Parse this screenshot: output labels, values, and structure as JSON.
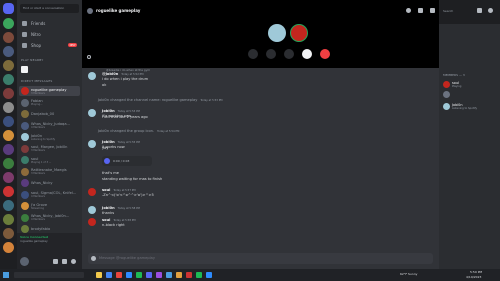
{
  "sidebar": {
    "search_placeholder": "Find or start a conversation",
    "nav": [
      {
        "label": "Friends",
        "badge": ""
      },
      {
        "label": "Nitro",
        "badge": ""
      },
      {
        "label": "Shop",
        "badge": "NEW"
      }
    ],
    "section_play": "PLAY NEARBY",
    "section_dm": "DIRECT MESSAGES",
    "dms": [
      {
        "name": "roguelike gameplay",
        "sub": "3 Members",
        "active": true
      },
      {
        "name": "Fabian",
        "sub": "Playing..."
      },
      {
        "name": "Danjakob_00",
        "sub": ""
      },
      {
        "name": "Whos_Nicky_Judaqa...",
        "sub": "4 Members"
      },
      {
        "name": "Jobi0n",
        "sub": "Listening to Spotify"
      },
      {
        "name": "soul, Margee, Jobi0n",
        "sub": "3 Members"
      },
      {
        "name": "soul",
        "sub": "Playing 1 of 3 ..."
      },
      {
        "name": "Rattlesnake_Maegis",
        "sub": "3 Members"
      },
      {
        "name": "Whos_Nicky",
        "sub": ""
      },
      {
        "name": "soul, Sigma/COL, Knifel...",
        "sub": "4 Members"
      },
      {
        "name": "J'a Grove",
        "sub": "Streaming"
      },
      {
        "name": "Whos_Nicky, Jobi0n...",
        "sub": "4 Members"
      },
      {
        "name": "brodyfabio",
        "sub": ""
      }
    ],
    "voice": {
      "status": "Voice Connected",
      "channel": "roguelike gameplay"
    }
  },
  "header": {
    "title": "roguelike gameplay",
    "search": "Search"
  },
  "chat": {
    "messages": [
      {
        "type": "msg",
        "name": "@Jobi0n",
        "time": "Today at 5:52 PM",
        "text": "i do when i play the drum",
        "reply": "@breadie i do when at the gym"
      },
      {
        "type": "msg",
        "name": "",
        "time": "",
        "text": "ok"
      },
      {
        "type": "sys",
        "text": "Jobi0n changed the channel name: roguelike gameplay",
        "time": "Today at 5:53 PM"
      },
      {
        "type": "msg",
        "name": "Jobi0n",
        "time": "Today at 5:53 PM",
        "text": "it's working now"
      },
      {
        "type": "msg",
        "name": "",
        "time": "",
        "text": "i did that like 2 years ago"
      },
      {
        "type": "sys",
        "text": "Jobi0n changed the group icon.",
        "time": "Today at 5:54 PM"
      },
      {
        "type": "msg",
        "name": "Jobi0n",
        "time": "Today at 5:55 PM",
        "text": "it works now"
      },
      {
        "type": "msg",
        "name": "",
        "time": "",
        "text": "yay"
      },
      {
        "type": "audio",
        "duration": "0:00 / 0:03"
      },
      {
        "type": "msg",
        "name": "",
        "time": "",
        "text": "that's me"
      },
      {
        "type": "msg",
        "name": "",
        "time": "",
        "text": "standing waiting for mas to finish"
      },
      {
        "type": "msg",
        "name": "soul",
        "time": "Today at 5:57 PM",
        "text": "-Zn^<('o'<^o^^>'o')>^>5"
      },
      {
        "type": "msg",
        "name": "Jobi0n",
        "time": "Today at 5:58 PM",
        "text": "thanks"
      },
      {
        "type": "msg",
        "name": "soul",
        "time": "Today at 5:58 PM",
        "text": "n-black right"
      }
    ],
    "input_placeholder": "Message @roguelike gameplay"
  },
  "members": {
    "header": "MEMBERS — 3",
    "list": [
      {
        "name": "soul",
        "sub": "Playing"
      },
      {
        "name": "Jobi0n",
        "sub": "Listening to Spotify"
      },
      {
        "name": "",
        "sub": ""
      }
    ]
  },
  "taskbar": {
    "time": "5:59 PM",
    "date": "4/19/2023",
    "weather": "62°F Sunny"
  },
  "colors": {
    "accent": "#5865f2",
    "danger": "#f23f42",
    "online": "#23a55a"
  }
}
